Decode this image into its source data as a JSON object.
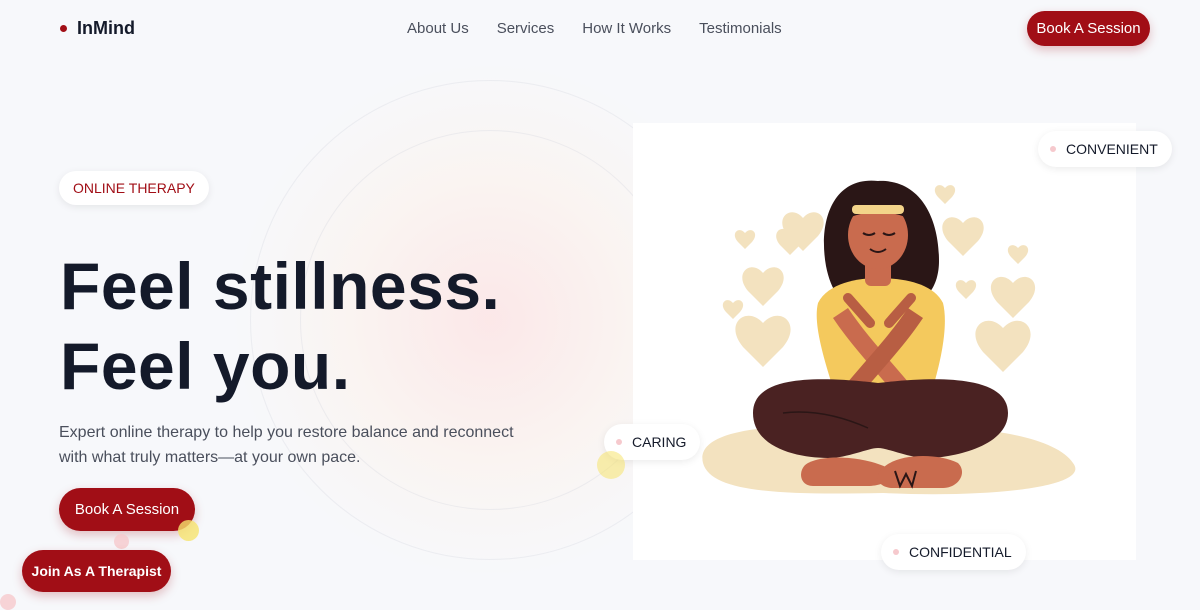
{
  "brand": {
    "name": "InMind"
  },
  "nav": {
    "links": [
      "About Us",
      "Services",
      "How It Works",
      "Testimonials"
    ],
    "cta_label": "Book A Session"
  },
  "hero": {
    "badge": "ONLINE THERAPY",
    "title_line1": "Feel stillness.",
    "title_line2": "Feel you.",
    "subtitle_line1": "Expert online therapy to help you restore balance and reconnect",
    "subtitle_line2": "with what truly matters—at your own pace.",
    "cta_label": "Book A Session"
  },
  "floating": {
    "join_label": "Join As A Therapist"
  },
  "illustration": {
    "chips": {
      "convenient": "CONVENIENT",
      "caring": "CARING",
      "confidential": "CONFIDENTIAL"
    }
  },
  "colors": {
    "accent": "#a10e16",
    "cream": "#f3e2bf",
    "skin": "#c96b4e",
    "pants": "#4a2222",
    "shirt": "#f4c95d"
  }
}
